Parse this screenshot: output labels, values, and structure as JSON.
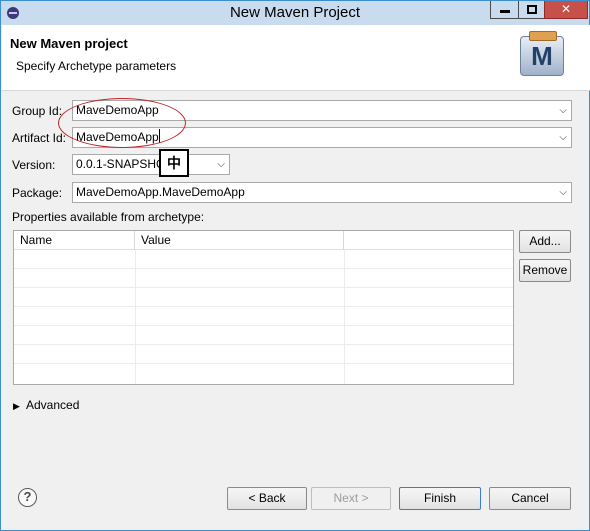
{
  "window": {
    "title": "New Maven Project"
  },
  "header": {
    "title": "New Maven project",
    "subtitle": "Specify Archetype parameters",
    "icon_letter": "M"
  },
  "form": {
    "group_id": {
      "label": "Group Id:",
      "value": "MaveDemoApp"
    },
    "artifact_id": {
      "label": "Artifact Id:",
      "value": "MaveDemoApp"
    },
    "version": {
      "label": "Version:",
      "value": "0.0.1-SNAPSHO"
    },
    "package": {
      "label": "Package:",
      "value": "MaveDemoApp.MaveDemoApp"
    },
    "ime_indicator": "中"
  },
  "properties": {
    "label": "Properties available from archetype:",
    "columns": [
      "Name",
      "Value",
      ""
    ],
    "add_label": "Add...",
    "remove_label": "Remove"
  },
  "advanced": {
    "label": "Advanced",
    "expand_glyph": "▶"
  },
  "footer": {
    "help_glyph": "?",
    "back_label": "< Back",
    "next_label": "Next >",
    "finish_label": "Finish",
    "cancel_label": "Cancel"
  },
  "colors": {
    "annotation_circle": "#c0262b",
    "titlebar": "#c9dcef",
    "close_button": "#c7504a"
  }
}
